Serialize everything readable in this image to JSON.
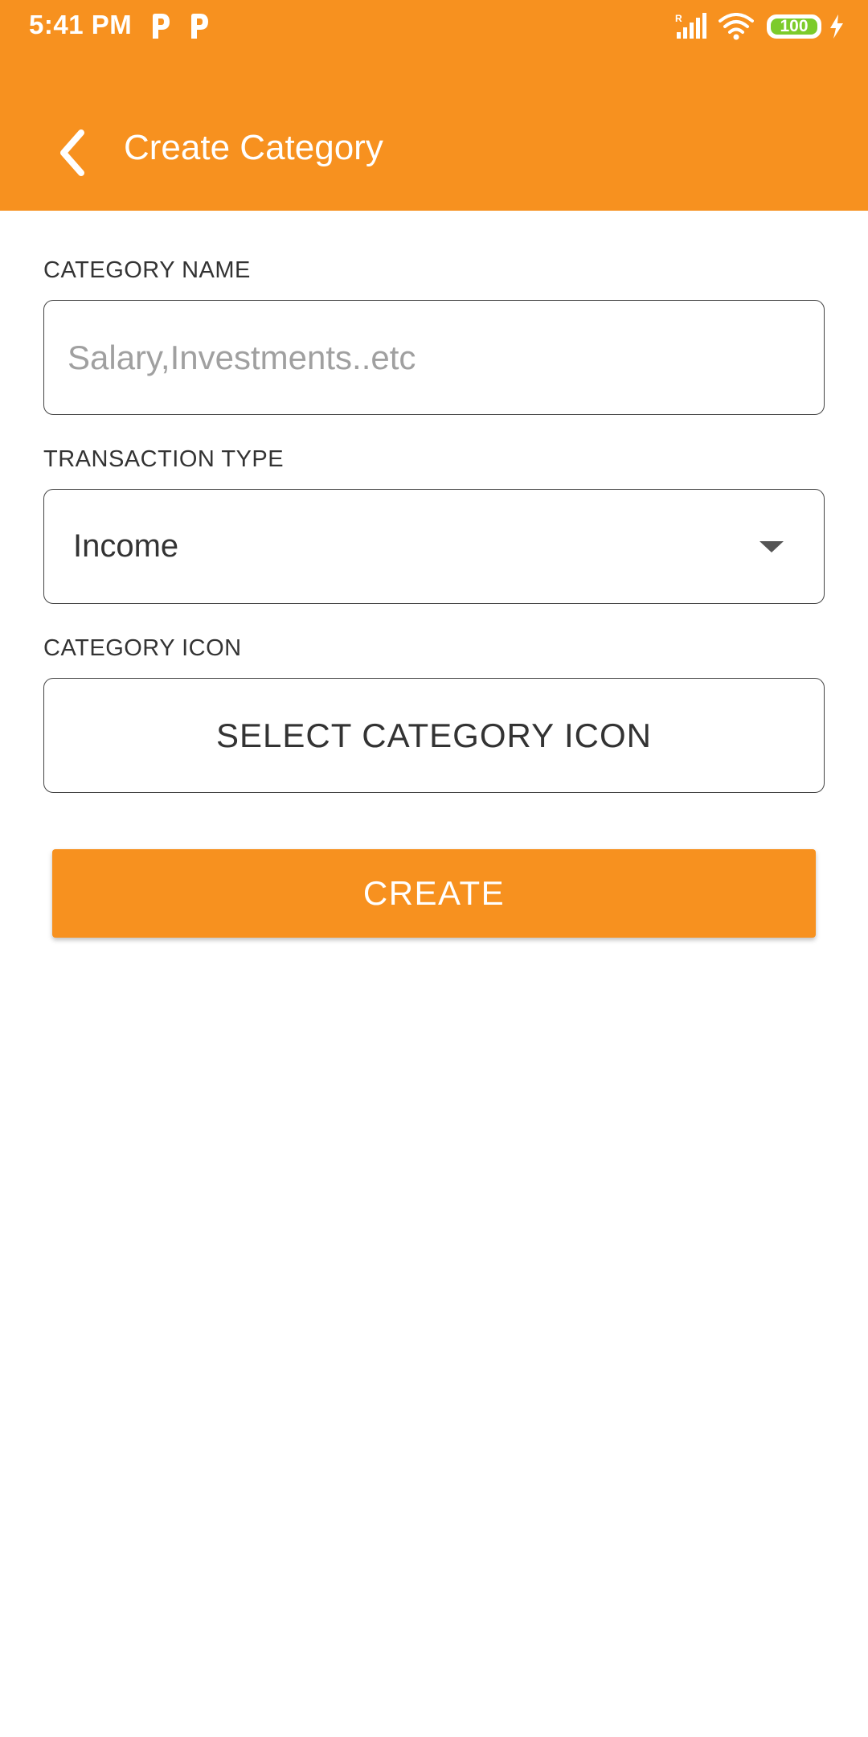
{
  "status_bar": {
    "time": "5:41 PM",
    "notification_icons": [
      "parking-p-icon",
      "parking-p-icon"
    ],
    "signal_icon": "signal-roaming-icon",
    "wifi_icon": "wifi-icon",
    "battery_level": "100",
    "charging_icon": "charging-bolt-icon"
  },
  "app_bar": {
    "back_icon": "chevron-left-icon",
    "title": "Create Category",
    "color": "#f7911f"
  },
  "form": {
    "category_name": {
      "label": "CATEGORY NAME",
      "value": "",
      "placeholder": "Salary,Investments..etc"
    },
    "transaction_type": {
      "label": "TRANSACTION TYPE",
      "selected": "Income",
      "arrow_icon": "dropdown-arrow-icon"
    },
    "category_icon": {
      "label": "CATEGORY ICON",
      "button_label": "SELECT CATEGORY ICON"
    },
    "create_button": {
      "label": "CREATE",
      "color": "#f7911f"
    }
  }
}
